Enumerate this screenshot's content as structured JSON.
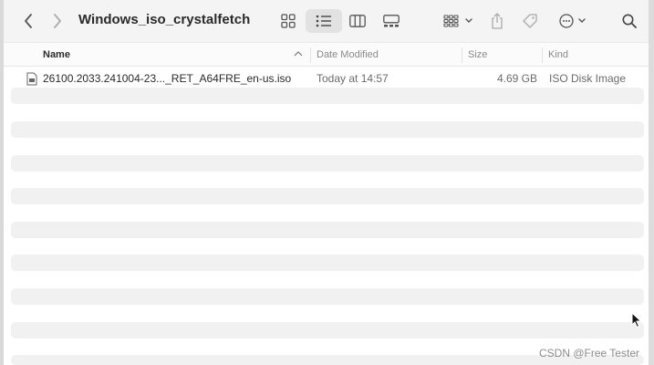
{
  "window": {
    "title": "Windows_iso_crystalfetch"
  },
  "toolbar": {
    "icons": [
      "chevron-left-icon",
      "chevron-right-icon",
      "grid-view-icon",
      "list-view-icon",
      "column-view-icon",
      "gallery-view-icon",
      "group-icon",
      "share-icon",
      "tag-icon",
      "more-icon",
      "search-icon"
    ]
  },
  "columns": {
    "name": "Name",
    "date_modified": "Date Modified",
    "size": "Size",
    "kind": "Kind"
  },
  "files": [
    {
      "name": "26100.2033.241004-23..._RET_A64FRE_en-us.iso",
      "date_modified": "Today at 14:57",
      "size": "4.69 GB",
      "kind": "ISO Disk Image"
    }
  ],
  "watermark": "CSDN @Free Tester"
}
